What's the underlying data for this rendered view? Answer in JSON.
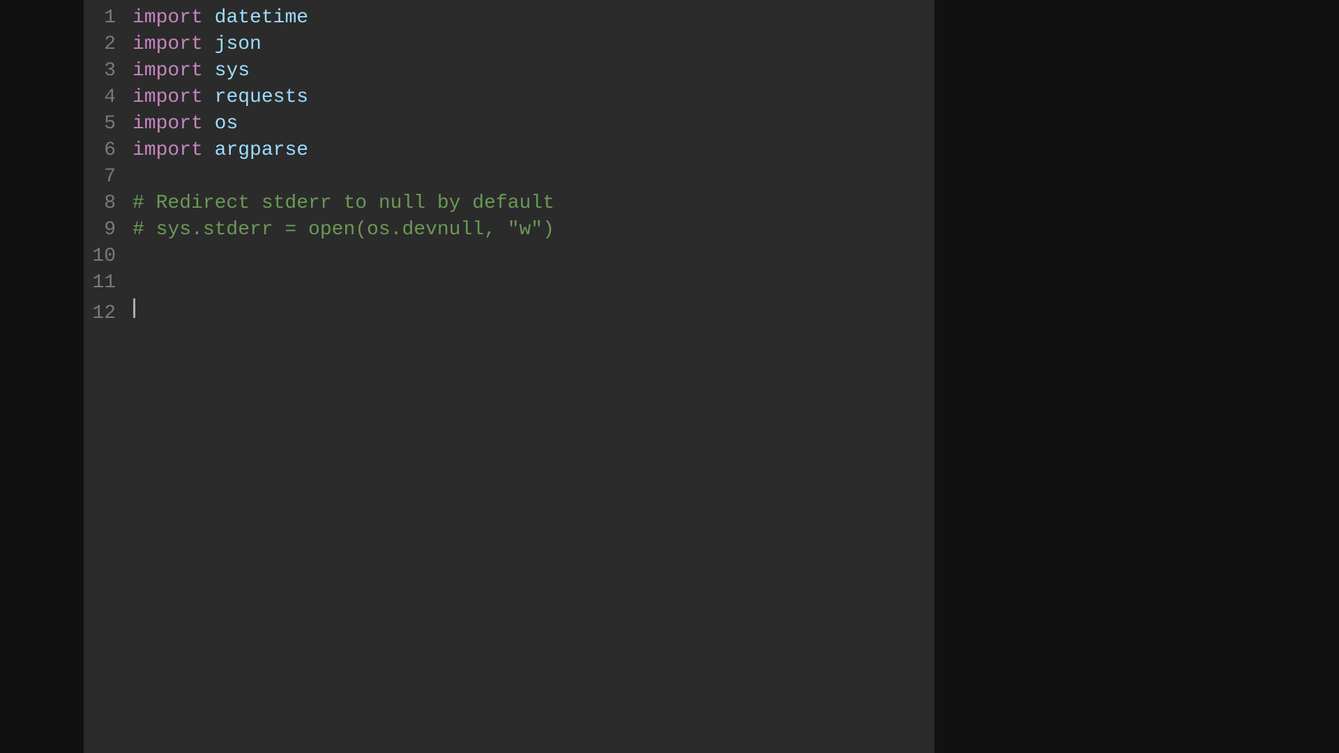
{
  "editor": {
    "background_main": "#2b2b2b",
    "background_outer": "#111111",
    "lines": [
      {
        "number": "1",
        "tokens": [
          {
            "type": "keyword",
            "text": "import"
          },
          {
            "type": "space",
            "text": " "
          },
          {
            "type": "module",
            "text": "datetime"
          }
        ]
      },
      {
        "number": "2",
        "tokens": [
          {
            "type": "keyword",
            "text": "import"
          },
          {
            "type": "space",
            "text": " "
          },
          {
            "type": "module",
            "text": "json"
          }
        ]
      },
      {
        "number": "3",
        "tokens": [
          {
            "type": "keyword",
            "text": "import"
          },
          {
            "type": "space",
            "text": " "
          },
          {
            "type": "module",
            "text": "sys"
          }
        ]
      },
      {
        "number": "4",
        "tokens": [
          {
            "type": "keyword",
            "text": "import"
          },
          {
            "type": "space",
            "text": " "
          },
          {
            "type": "module",
            "text": "requests"
          }
        ]
      },
      {
        "number": "5",
        "tokens": [
          {
            "type": "keyword",
            "text": "import"
          },
          {
            "type": "space",
            "text": " "
          },
          {
            "type": "module",
            "text": "os"
          }
        ]
      },
      {
        "number": "6",
        "tokens": [
          {
            "type": "keyword",
            "text": "import"
          },
          {
            "type": "space",
            "text": " "
          },
          {
            "type": "module",
            "text": "argparse"
          }
        ]
      },
      {
        "number": "7",
        "tokens": []
      },
      {
        "number": "8",
        "tokens": [
          {
            "type": "comment",
            "text": "# Redirect stderr to null by default"
          }
        ]
      },
      {
        "number": "9",
        "tokens": [
          {
            "type": "comment",
            "text": "# sys.stderr = open(os.devnull, \"w\")"
          }
        ]
      },
      {
        "number": "10",
        "tokens": []
      },
      {
        "number": "11",
        "tokens": []
      },
      {
        "number": "12",
        "tokens": [],
        "cursor": true
      }
    ]
  }
}
